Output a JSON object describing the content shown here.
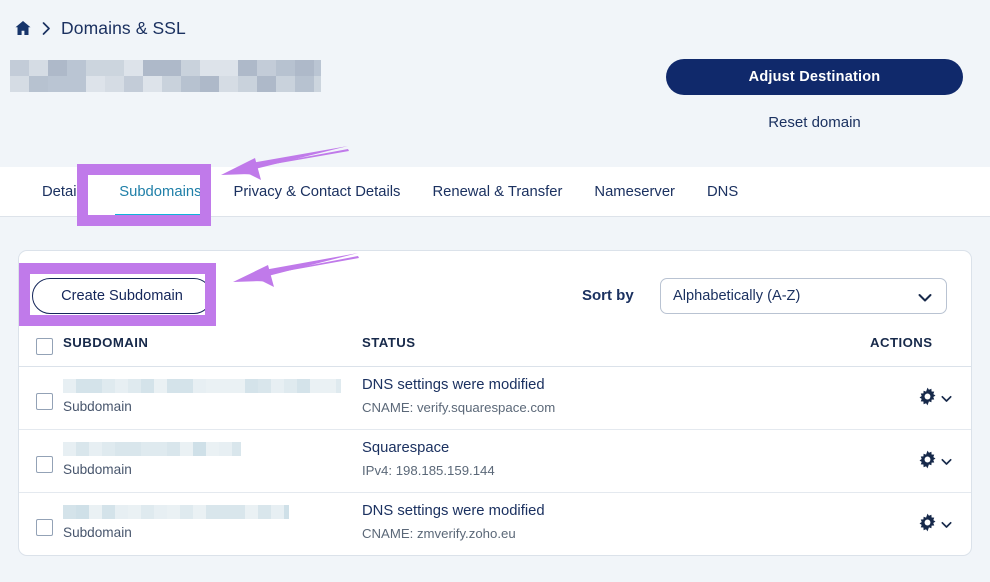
{
  "breadcrumb": {
    "home_icon": "home-icon",
    "separator_icon": "chevron-right-icon",
    "label": "Domains & SSL"
  },
  "header": {
    "domain_title_redacted": true,
    "adjust_button_label": "Adjust Destination",
    "reset_link_label": "Reset domain"
  },
  "tabs": [
    {
      "label": "Details",
      "active": false
    },
    {
      "label": "Subdomains",
      "active": true
    },
    {
      "label": "Privacy & Contact Details",
      "active": false
    },
    {
      "label": "Renewal & Transfer",
      "active": false
    },
    {
      "label": "Nameserver",
      "active": false
    },
    {
      "label": "DNS",
      "active": false
    }
  ],
  "toolbar": {
    "create_button_label": "Create Subdomain",
    "sort_by_label": "Sort by",
    "sort_selected": "Alphabetically (A-Z)",
    "sort_options": [
      "Alphabetically (A-Z)"
    ],
    "sort_chevron_icon": "chevron-down-icon"
  },
  "table": {
    "columns": [
      "SUBDOMAIN",
      "STATUS",
      "ACTIONS"
    ],
    "rows": [
      {
        "subdomain_redacted": true,
        "subdomain_blur_width": 278,
        "type_label": "Subdomain",
        "status": "DNS settings were modified",
        "status_detail": "CNAME: verify.squarespace.com",
        "action_icon": "gear-icon",
        "action_chevron_icon": "chevron-down-icon"
      },
      {
        "subdomain_redacted": true,
        "subdomain_blur_width": 178,
        "type_label": "Subdomain",
        "status": "Squarespace",
        "status_detail": "IPv4: 198.185.159.144",
        "action_icon": "gear-icon",
        "action_chevron_icon": "chevron-down-icon"
      },
      {
        "subdomain_redacted": true,
        "subdomain_blur_width": 226,
        "type_label": "Subdomain",
        "status": "DNS settings were modified",
        "status_detail": "CNAME: zmverify.zoho.eu",
        "action_icon": "gear-icon",
        "action_chevron_icon": "chevron-down-icon"
      }
    ]
  },
  "annotations": {
    "highlight_color": "#c07aea",
    "boxes": [
      {
        "target": "subdomains-tab"
      },
      {
        "target": "create-subdomain-button"
      }
    ],
    "arrows": [
      {
        "target": "subdomains-tab"
      },
      {
        "target": "create-subdomain-button"
      }
    ]
  },
  "colors": {
    "page_background": "#f1f5f9",
    "primary_button": "#10296b",
    "active_tab": "#1f7fa8",
    "active_tab_underline": "#11b3d8",
    "annotation_purple": "#c07aea"
  }
}
